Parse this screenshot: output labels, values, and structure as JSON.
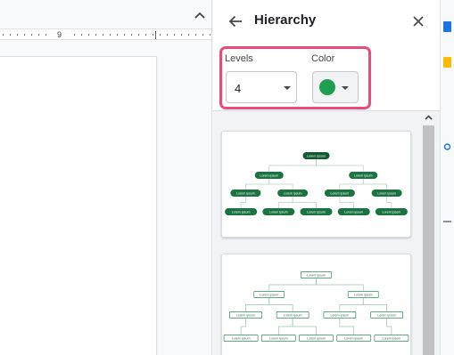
{
  "ruler": {
    "marker": "9"
  },
  "panel": {
    "title": "Hierarchy",
    "levels_label": "Levels",
    "levels_value": "4",
    "color_label": "Color",
    "selected_color": "#1e9e4e"
  },
  "colors": {
    "highlight": "#ea4b7c",
    "node_fill": "#1a7340",
    "node_fill_dark": "#0f5c32",
    "node_outline": "#2e8b57"
  },
  "templates": [
    {
      "style": "filled",
      "node_text": "Lorem ipsum"
    },
    {
      "style": "outlined",
      "node_text": "Lorem ipsum"
    }
  ],
  "icons": [
    "arrow-back-icon",
    "close-icon",
    "dropdown-caret-icon",
    "chevron-up-icon"
  ]
}
